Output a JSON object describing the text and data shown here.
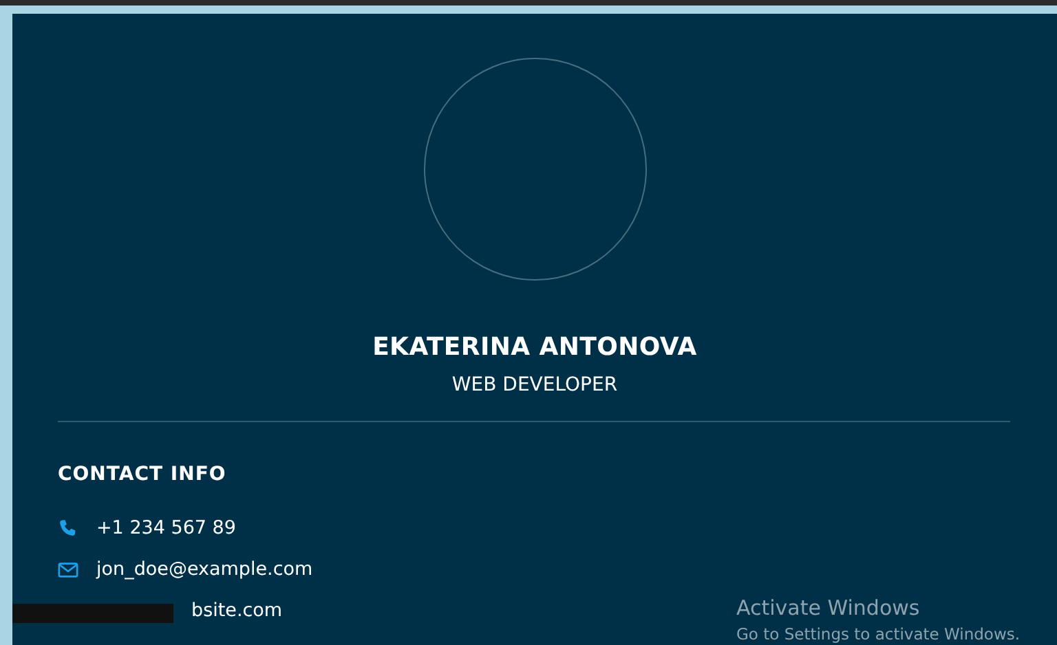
{
  "profile": {
    "name": "EKATERINA ANTONOVA",
    "title": "WEB DEVELOPER"
  },
  "contact": {
    "heading": "CONTACT INFO",
    "items": [
      {
        "kind": "phone",
        "text": "+1 234 567 89"
      },
      {
        "kind": "email",
        "text": "jon_doe@example.com"
      },
      {
        "kind": "covered",
        "text": "bsite.com"
      }
    ]
  },
  "os_notice": {
    "title": "Activate Windows",
    "text": "Go to Settings to activate Windows."
  }
}
